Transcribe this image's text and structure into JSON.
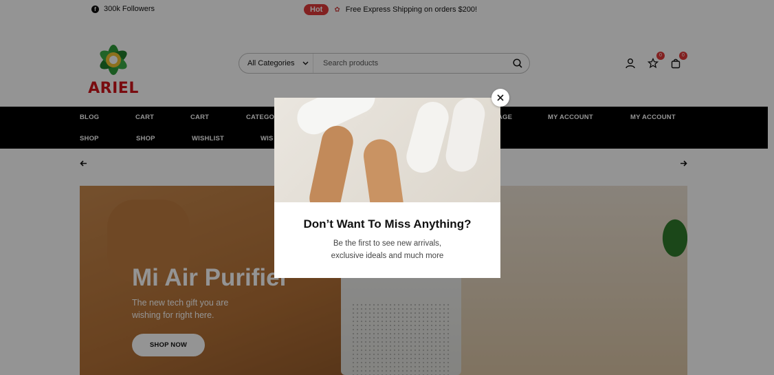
{
  "topbar": {
    "followers_icon": "facebook-icon",
    "followers_text": "300k Followers",
    "hot_badge": "Hot",
    "gift_icon": "gift-icon",
    "promo_text": "Free Express Shipping on orders $200!"
  },
  "header": {
    "logo_text": "ARIEL",
    "brand_colors": {
      "red": "#d1141b",
      "green": "#2e9b3a"
    },
    "category_select": "All Categories",
    "search_placeholder": "Search products",
    "wishlist_count": "0",
    "cart_count": "0",
    "icons": [
      "search-icon",
      "user-icon",
      "star-icon",
      "bag-icon"
    ]
  },
  "nav": {
    "row1": [
      "BLOG",
      "CART",
      "CART",
      "CATEGO",
      "AGE",
      "MY ACCOUNT",
      "MY ACCOUNT"
    ],
    "row2": [
      "SHOP",
      "SHOP",
      "WISHLIST",
      "WIS"
    ]
  },
  "slider": {
    "prev_icon": "arrow-left-icon",
    "next_icon": "arrow-right-icon"
  },
  "hero": {
    "title": "Mi Air Purifier",
    "subtitle": "The new tech gift you are wishing for right here.",
    "button": "SHOP NOW"
  },
  "modal": {
    "title": "Don’t Want To Miss Anything?",
    "text": "Be the first to see new arrivals, exclusive ideals and much more",
    "close_icon": "close-icon"
  }
}
